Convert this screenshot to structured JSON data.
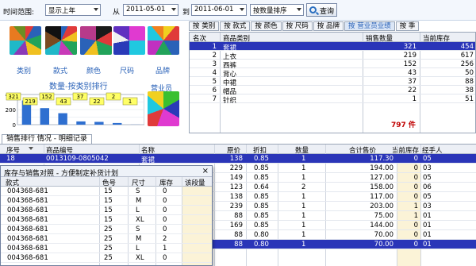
{
  "toolbar": {
    "range_label": "时间范围:",
    "range_value": "显示上年",
    "from_label": "从",
    "from_date": "2011-05-01",
    "to_label": "到",
    "to_date": "2011-06-01",
    "sort_value": "按数量排序",
    "query_label": "查询"
  },
  "left_panel": {
    "pie_labels": [
      "类别",
      "款式",
      "颜色",
      "尺码",
      "品牌"
    ],
    "staff_label": "营业员",
    "chart_title": "数量-按类别排行"
  },
  "chart_data": {
    "type": "bar",
    "categories": [
      "套裙",
      "上衣",
      "西裤",
      "背心",
      "中裙",
      "帽品",
      "针织"
    ],
    "values": [
      321,
      219,
      152,
      43,
      37,
      22,
      1
    ],
    "data_labels": [
      "321",
      "219",
      "152",
      "43",
      "37",
      "22",
      "2",
      "1"
    ],
    "ylim": [
      0,
      400
    ],
    "y_ticks": [
      "400",
      "200",
      "0"
    ],
    "bar_color": "#2e6fd0",
    "label_bg": "#ffff66"
  },
  "tabs_top": [
    "按 类别",
    "按 款式",
    "按 颜色",
    "按 尺码",
    "按 品牌",
    "按 营业员业绩",
    "按 季"
  ],
  "rank_table": {
    "headers": [
      "名次",
      "商品类别",
      "销售数量",
      "当前库存"
    ],
    "rows": [
      {
        "rank": "1",
        "category": "套裙",
        "qty": "321",
        "stock": "454"
      },
      {
        "rank": "2",
        "category": "上衣",
        "qty": "219",
        "stock": "617"
      },
      {
        "rank": "3",
        "category": "西裤",
        "qty": "152",
        "stock": "256"
      },
      {
        "rank": "4",
        "category": "背心",
        "qty": "43",
        "stock": "50"
      },
      {
        "rank": "5",
        "category": "中裙",
        "qty": "37",
        "stock": "88"
      },
      {
        "rank": "6",
        "category": "帽品",
        "qty": "22",
        "stock": "38"
      },
      {
        "rank": "7",
        "category": "针织",
        "qty": "1",
        "stock": "51"
      }
    ],
    "total_label": "797 件"
  },
  "detail_tab_label": "销售排行 情况 - 明细记录",
  "detail_table": {
    "headers": [
      "序号",
      "商品编号",
      "名称",
      "原价",
      "折扣",
      "数量",
      "合计售价",
      "当前库存",
      "经手人"
    ],
    "rows": [
      {
        "seq": "18",
        "code": "0013109-0805042",
        "name": "套裙",
        "price": "138",
        "disc": "0.85",
        "qty": "1",
        "total": "117.30",
        "stock": "0",
        "staff": "05"
      },
      {
        "seq": "",
        "code": "",
        "name": "",
        "price": "229",
        "disc": "0.85",
        "qty": "1",
        "total": "194.00",
        "stock": "0",
        "staff": "03"
      },
      {
        "seq": "",
        "code": "",
        "name": "",
        "price": "149",
        "disc": "0.85",
        "qty": "1",
        "total": "127.00",
        "stock": "0",
        "staff": "05"
      },
      {
        "seq": "",
        "code": "",
        "name": "",
        "price": "123",
        "disc": "0.64",
        "qty": "2",
        "total": "158.00",
        "stock": "0",
        "staff": "06"
      },
      {
        "seq": "",
        "code": "",
        "name": "",
        "price": "138",
        "disc": "0.85",
        "qty": "1",
        "total": "117.00",
        "stock": "0",
        "staff": "05"
      },
      {
        "seq": "",
        "code": "",
        "name": "",
        "price": "239",
        "disc": "0.85",
        "qty": "1",
        "total": "203.00",
        "stock": "1",
        "staff": "03"
      },
      {
        "seq": "",
        "code": "",
        "name": "",
        "price": "88",
        "disc": "0.85",
        "qty": "1",
        "total": "75.00",
        "stock": "1",
        "staff": "01"
      },
      {
        "seq": "",
        "code": "",
        "name": "",
        "price": "169",
        "disc": "0.85",
        "qty": "1",
        "total": "144.00",
        "stock": "0",
        "staff": "01"
      },
      {
        "seq": "",
        "code": "",
        "name": "",
        "price": "88",
        "disc": "0.80",
        "qty": "1",
        "total": "70.00",
        "stock": "0",
        "staff": "01"
      },
      {
        "seq": "",
        "code": "",
        "name": "",
        "price": "88",
        "disc": "0.80",
        "qty": "1",
        "total": "70.00",
        "stock": "0",
        "staff": "01"
      }
    ]
  },
  "popup": {
    "title": "库存与销售对照 - 方便制定补货计划",
    "close": "×",
    "headers": [
      "款式",
      "色号",
      "尺寸",
      "库存",
      "该段量"
    ],
    "rows": [
      {
        "style": "004368-681",
        "color": "15",
        "size": "S",
        "stock": "0"
      },
      {
        "style": "004368-681",
        "color": "15",
        "size": "M",
        "stock": "0"
      },
      {
        "style": "004368-681",
        "color": "15",
        "size": "L",
        "stock": "0"
      },
      {
        "style": "004368-681",
        "color": "15",
        "size": "XL",
        "stock": "0"
      },
      {
        "style": "004368-681",
        "color": "25",
        "size": "S",
        "stock": "0"
      },
      {
        "style": "004368-681",
        "color": "25",
        "size": "M",
        "stock": "2"
      },
      {
        "style": "004368-681",
        "color": "25",
        "size": "L",
        "stock": "1"
      },
      {
        "style": "004368-681",
        "color": "25",
        "size": "XL",
        "stock": "0"
      }
    ]
  }
}
